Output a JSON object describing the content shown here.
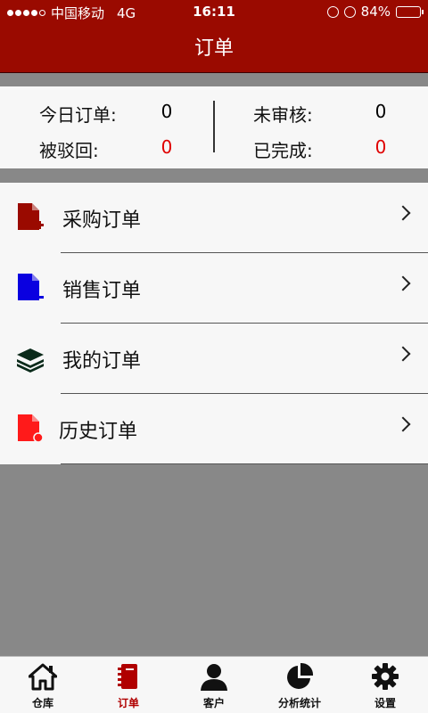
{
  "status_bar": {
    "carrier": "中国移动",
    "network": "4G",
    "time": "16:11",
    "battery": "84%",
    "battery_level": 0.84
  },
  "header": {
    "title": "订单"
  },
  "summary": {
    "today_label": "今日订单:",
    "today_value": "0",
    "unreviewed_label": "未审核:",
    "unreviewed_value": "0",
    "rejected_label": "被驳回:",
    "rejected_value": "0",
    "completed_label": "已完成:",
    "completed_value": "0"
  },
  "menu": {
    "items": [
      {
        "label": "采购订单",
        "icon": "purchase-doc-icon",
        "color": "#9a0a00"
      },
      {
        "label": "销售订单",
        "icon": "sales-doc-icon",
        "color": "#0a00e0"
      },
      {
        "label": "我的订单",
        "icon": "layers-icon",
        "color": "#0a2a1a"
      },
      {
        "label": "历史订单",
        "icon": "history-doc-icon",
        "color": "#ff1a1a"
      }
    ]
  },
  "tabbar": {
    "tabs": [
      {
        "label": "仓库",
        "icon": "home-icon"
      },
      {
        "label": "订单",
        "icon": "notebook-icon",
        "active": true
      },
      {
        "label": "客户",
        "icon": "user-icon"
      },
      {
        "label": "分析统计",
        "icon": "pie-chart-icon"
      },
      {
        "label": "设置",
        "icon": "gear-icon"
      }
    ]
  },
  "colors": {
    "brand": "#9a0a00",
    "alert": "#e00000",
    "background": "#888888"
  }
}
